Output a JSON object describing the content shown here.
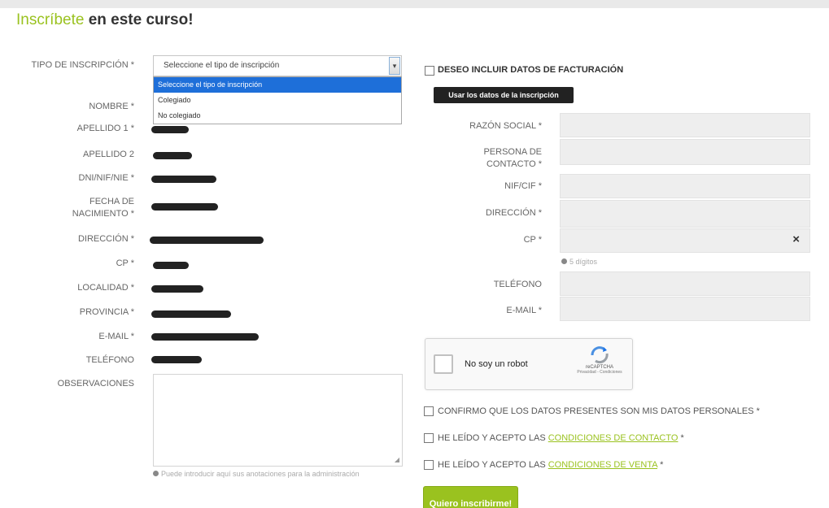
{
  "title": {
    "accent": "Inscríbete",
    "rest": " en este curso!"
  },
  "left_form": {
    "tipo_label": "TIPO DE INSCRIPCIÓN *",
    "tipo_select": {
      "value": "Seleccione el tipo de inscripción",
      "options": [
        "Seleccione el tipo de inscripción",
        "Colegiado",
        "No colegiado"
      ]
    },
    "labels": {
      "nombre": "NOMBRE *",
      "apellido1": "APELLIDO 1 *",
      "apellido2": "APELLIDO 2",
      "dni": "DNI/NIF/NIE *",
      "fecha": "FECHA DE NACIMIENTO *",
      "direccion": "DIRECCIÓN *",
      "cp": "CP *",
      "localidad": "LOCALIDAD *",
      "provincia": "PROVINCIA *",
      "email": "E-MAIL *",
      "telefono": "TELÉFONO",
      "observaciones": "OBSERVACIONES"
    },
    "observaciones_hint": "Puede introducir aquí sus anotaciones para la administración"
  },
  "billing": {
    "checkbox_label": "DESEO INCLUIR DATOS DE FACTURACIÓN",
    "use_data_button": "Usar los datos de la inscripción",
    "labels": {
      "razon_social": "RAZÓN SOCIAL *",
      "persona_contacto": "PERSONA DE CONTACTO *",
      "nif": "NIF/CIF *",
      "direccion": "DIRECCIÓN *",
      "cp": "CP *",
      "telefono": "TELÉFONO",
      "email": "E-MAIL *"
    },
    "cp_hint": "5 dígitos",
    "cp_clear": "×"
  },
  "captcha": {
    "label": "No soy un robot",
    "brand": "reCAPTCHA",
    "terms": "Privacidad - Condiciones"
  },
  "confirmations": {
    "datos_personales": "CONFIRMO QUE LOS DATOS PRESENTES SON MIS DATOS PERSONALES *",
    "contacto_prefix": "HE LEÍDO Y ACEPTO LAS ",
    "contacto_link": "CONDICIONES DE CONTACTO",
    "venta_prefix": "HE LEÍDO Y ACEPTO LAS ",
    "venta_link": "CONDICIONES DE VENTA",
    "required_mark": "*"
  },
  "submit_label": "Quiero inscribirme!",
  "colors": {
    "accent": "#9ac21f",
    "dropdown_selected": "#1e6fd9",
    "dark_button": "#222222"
  }
}
